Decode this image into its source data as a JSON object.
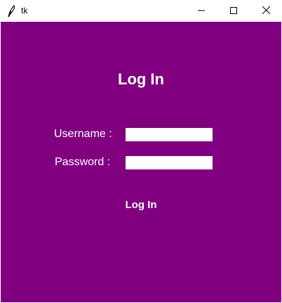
{
  "window": {
    "title": "tk",
    "icon": "feather-icon",
    "controls": [
      "minimize-icon",
      "maximize-icon",
      "close-icon"
    ]
  },
  "colors": {
    "background": "#800080",
    "text": "#ffffff",
    "entry_background": "#ffffff"
  },
  "form": {
    "heading": "Log In",
    "username_label": "Username :",
    "username_value": "",
    "password_label": "Password :",
    "password_value": "",
    "submit_label": "Log In"
  }
}
